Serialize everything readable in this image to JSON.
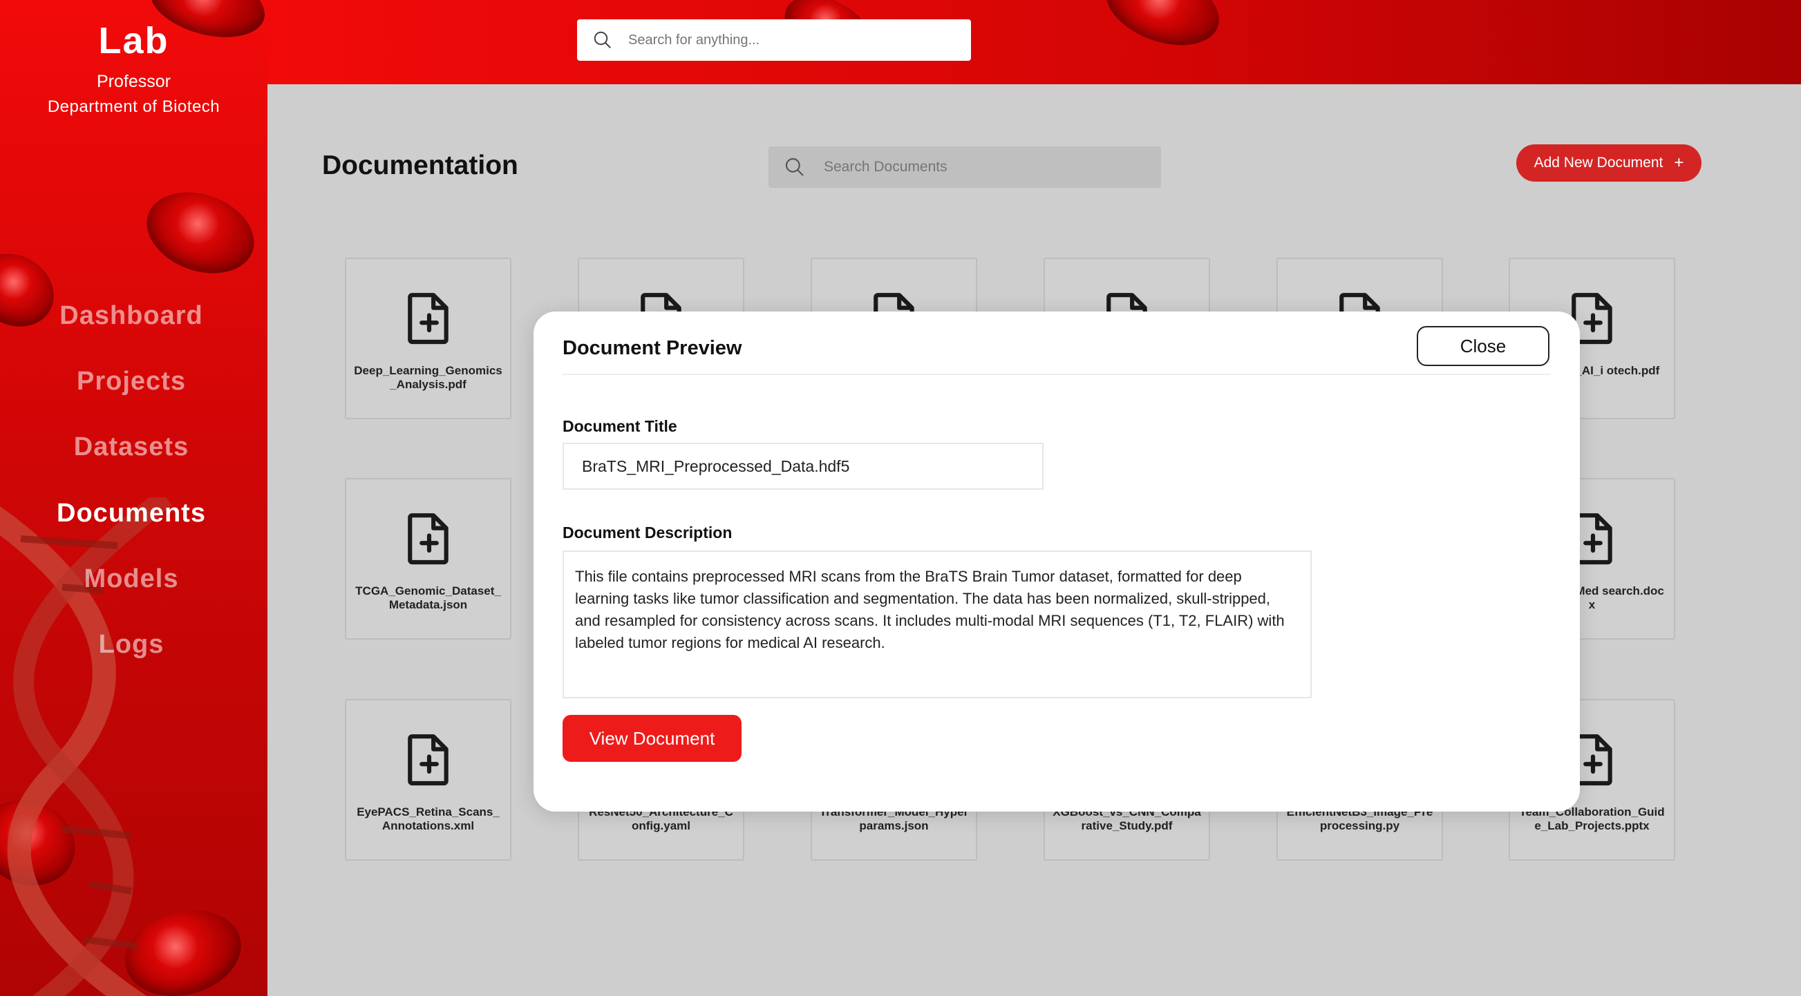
{
  "sidebar": {
    "brand": "Lab",
    "role": "Professor",
    "department": "Department of Biotech",
    "nav": [
      {
        "label": "Dashboard",
        "active": false
      },
      {
        "label": "Projects",
        "active": false
      },
      {
        "label": "Datasets",
        "active": false
      },
      {
        "label": "Documents",
        "active": true
      },
      {
        "label": "Models",
        "active": false
      },
      {
        "label": "Logs",
        "active": false
      }
    ]
  },
  "topbar": {
    "search_placeholder": "Search for anything...",
    "search_icon": "search-icon"
  },
  "main": {
    "title": "Documentation",
    "search_placeholder": "Search Documents",
    "add_button_label": "Add New Document",
    "add_button_icon": "+",
    "cards": [
      "Deep_Learning_Genomics_Analysis.pdf",
      "",
      "",
      "",
      "",
      "mpliance_AI_i otech.pdf",
      "TCGA_Genomic_Dataset_Metadata.json",
      "",
      "",
      "",
      "",
      "posal_AI_Med search.docx",
      "EyePACS_Retina_Scans_Annotations.xml",
      "ResNet50_Architecture_Config.yaml",
      "Transformer_Model_Hyperparams.json",
      "XGBoost_vs_CNN_Comparative_Study.pdf",
      "EfficientNetB3_Image_Preprocessing.py",
      "Team_Collaboration_Guide_Lab_Projects.pptx"
    ]
  },
  "dialog": {
    "title": "Document Preview",
    "close_label": "Close",
    "doc_title_label": "Document Title",
    "doc_title_value": "BraTS_MRI_Preprocessed_Data.hdf5",
    "doc_desc_label": "Document Description",
    "doc_desc_value": "This file contains preprocessed MRI scans from the BraTS Brain Tumor dataset, formatted for deep learning tasks like tumor classification and segmentation. The data has been normalized, skull-stripped, and resampled for consistency across scans. It includes multi-modal MRI sequences (T1, T2, FLAIR) with labeled tumor regions for medical AI research.",
    "view_button_label": "View Document"
  },
  "colors": {
    "primary_red": "#ee1b1b",
    "sidebar_red": "#d00606",
    "add_button": "#d42525",
    "background": "#cecece"
  }
}
